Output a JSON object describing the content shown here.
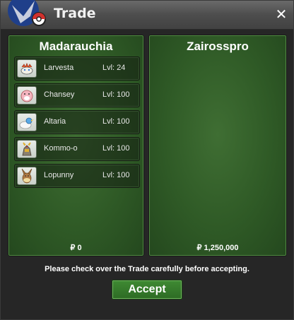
{
  "window": {
    "title": "Trade",
    "close_label": "✕"
  },
  "left_panel": {
    "trainer": "Madarauchia",
    "money": "₽ 0",
    "pokemon": [
      {
        "name": "Larvesta",
        "level": "Lvl: 24",
        "icon": "larvesta-icon"
      },
      {
        "name": "Chansey",
        "level": "Lvl: 100",
        "icon": "chansey-icon"
      },
      {
        "name": "Altaria",
        "level": "Lvl: 100",
        "icon": "altaria-icon"
      },
      {
        "name": "Kommo-o",
        "level": "Lvl: 100",
        "icon": "kommo-o-icon"
      },
      {
        "name": "Lopunny",
        "level": "Lvl: 100",
        "icon": "lopunny-icon"
      }
    ]
  },
  "right_panel": {
    "trainer": "Zairosspro",
    "money": "₽ 1,250,000",
    "pokemon": []
  },
  "footer": {
    "notice": "Please check over the Trade carefully before accepting.",
    "accept_label": "Accept"
  },
  "colors": {
    "panel_green": "#2f5a26",
    "button_green": "#3f8a33",
    "titlebar": "#555555"
  }
}
